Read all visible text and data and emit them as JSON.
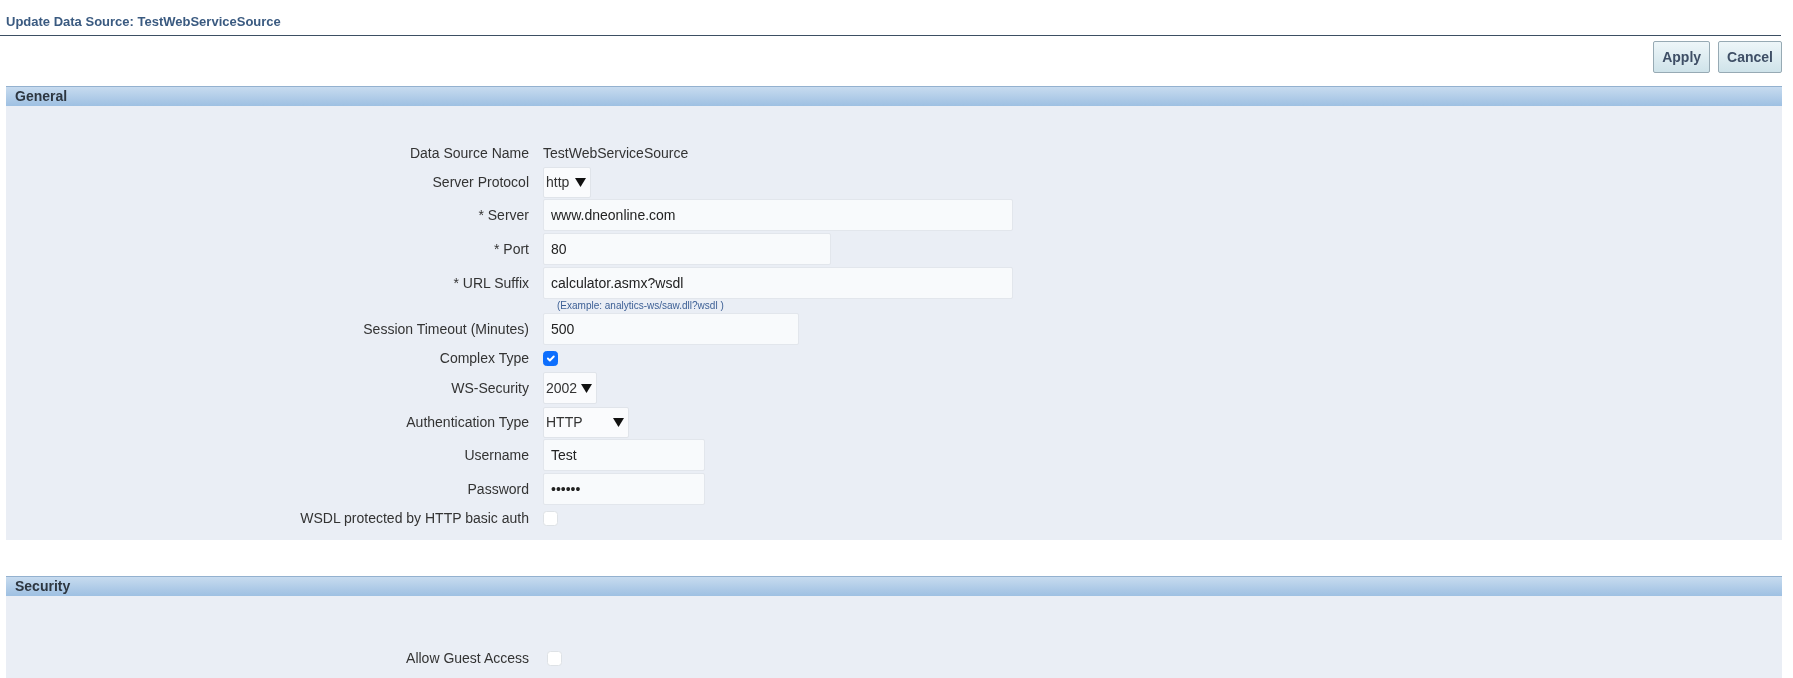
{
  "page_title": "Update Data Source: TestWebServiceSource",
  "buttons": [
    {
      "label": "Apply"
    },
    {
      "label": "Cancel"
    }
  ],
  "sections": [
    {
      "title": "General",
      "fields": [
        {
          "kind": "text",
          "label": "Data Source Name",
          "value": "TestWebServiceSource"
        },
        {
          "kind": "select",
          "label": "Server Protocol",
          "value": "http"
        },
        {
          "kind": "input",
          "label": "* Server",
          "value": "www.dneonline.com"
        },
        {
          "kind": "input",
          "label": "* Port",
          "value": "80"
        },
        {
          "kind": "input",
          "label": "* URL Suffix",
          "value": "calculator.asmx?wsdl",
          "hint": "(Example: analytics-ws/saw.dll?wsdl )"
        },
        {
          "kind": "input",
          "label": "Session Timeout (Minutes)",
          "value": "500"
        },
        {
          "kind": "checkbox",
          "label": "Complex Type",
          "checked": true
        },
        {
          "kind": "select",
          "label": "WS-Security",
          "value": "2002"
        },
        {
          "kind": "select",
          "label": "Authentication Type",
          "value": "HTTP"
        },
        {
          "kind": "input",
          "label": "Username",
          "value": "Test"
        },
        {
          "kind": "input",
          "label": "Password",
          "value": "••••••"
        },
        {
          "kind": "checkbox",
          "label": "WSDL protected by HTTP basic auth",
          "checked": false
        }
      ]
    },
    {
      "title": "Security",
      "fields": [
        {
          "kind": "checkbox",
          "label": "Allow Guest Access",
          "checked": false
        }
      ]
    }
  ]
}
